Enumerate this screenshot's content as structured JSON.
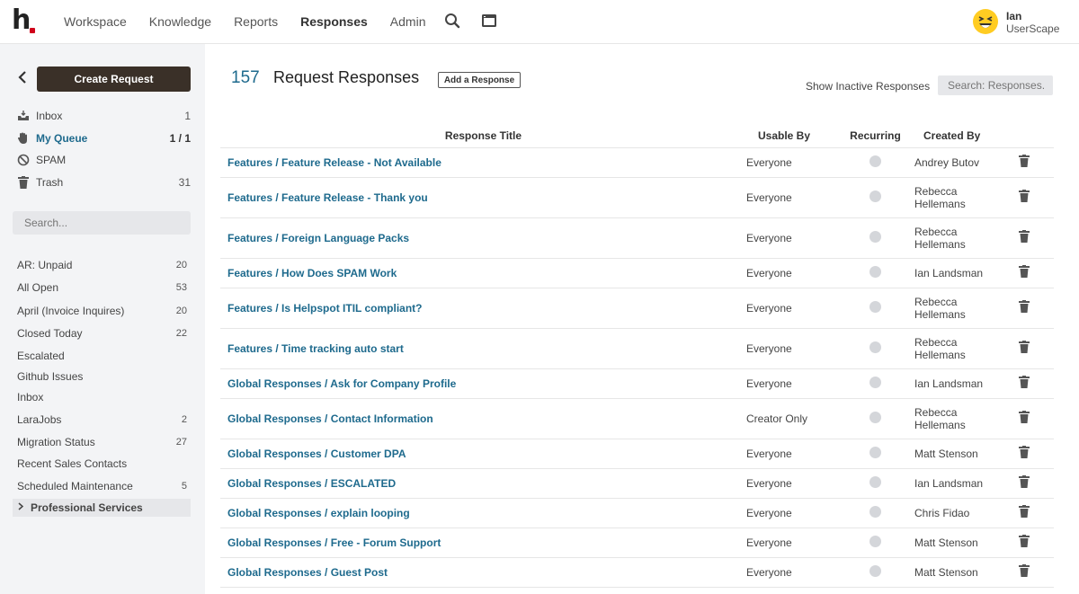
{
  "nav": {
    "items": [
      "Workspace",
      "Knowledge",
      "Reports",
      "Responses",
      "Admin"
    ],
    "active": "Responses",
    "search_icon": "search-icon",
    "window_icon": "window-icon"
  },
  "user": {
    "name": "Ian",
    "org": "UserScape",
    "avatar_icon": "laughing-face-emoji"
  },
  "sidebar": {
    "create_label": "Create Request",
    "folders": [
      {
        "label": "Inbox",
        "count": "1",
        "icon": "inbox-icon"
      },
      {
        "label": "My Queue",
        "count": "1 / 1",
        "icon": "hand-icon"
      },
      {
        "label": "SPAM",
        "count": "",
        "icon": "ban-icon"
      },
      {
        "label": "Trash",
        "count": "31",
        "icon": "trash-icon"
      }
    ],
    "search_placeholder": "Search...",
    "filters": [
      {
        "label": "AR: Unpaid",
        "count": "20"
      },
      {
        "label": "All Open",
        "count": "53"
      },
      {
        "label": "April (Invoice Inquires)",
        "count": "20"
      },
      {
        "label": "Closed Today",
        "count": "22"
      },
      {
        "label": "Escalated",
        "count": ""
      },
      {
        "label": "Github Issues",
        "count": ""
      },
      {
        "label": "Inbox",
        "count": ""
      },
      {
        "label": "LaraJobs",
        "count": "2"
      },
      {
        "label": "Migration Status",
        "count": "27"
      },
      {
        "label": "Recent Sales Contacts",
        "count": ""
      },
      {
        "label": "Scheduled Maintenance",
        "count": "5"
      }
    ],
    "group_label": "Professional Services"
  },
  "main": {
    "count": "157",
    "title": "Request Responses",
    "add_label": "Add a Response",
    "inactive_label": "Show Inactive Responses",
    "search_placeholder": "Search: Responses."
  },
  "table": {
    "headers": [
      "Response Title",
      "Usable By",
      "Recurring",
      "Created By"
    ],
    "rows": [
      {
        "title": "Features / Feature Release - Not Available",
        "usable": "Everyone",
        "creator": "Andrey Butov"
      },
      {
        "title": "Features / Feature Release - Thank you",
        "usable": "Everyone",
        "creator": "Rebecca Hellemans"
      },
      {
        "title": "Features / Foreign Language Packs",
        "usable": "Everyone",
        "creator": "Rebecca Hellemans"
      },
      {
        "title": "Features / How Does SPAM Work",
        "usable": "Everyone",
        "creator": "Ian Landsman"
      },
      {
        "title": "Features / Is Helpspot ITIL compliant?",
        "usable": "Everyone",
        "creator": "Rebecca Hellemans"
      },
      {
        "title": "Features / Time tracking auto start",
        "usable": "Everyone",
        "creator": "Rebecca Hellemans"
      },
      {
        "title": "Global Responses / Ask for Company Profile",
        "usable": "Everyone",
        "creator": "Ian Landsman"
      },
      {
        "title": "Global Responses / Contact Information",
        "usable": "Creator Only",
        "creator": "Rebecca Hellemans"
      },
      {
        "title": "Global Responses / Customer DPA",
        "usable": "Everyone",
        "creator": "Matt Stenson"
      },
      {
        "title": "Global Responses / ESCALATED",
        "usable": "Everyone",
        "creator": "Ian Landsman"
      },
      {
        "title": "Global Responses / explain looping",
        "usable": "Everyone",
        "creator": "Chris Fidao"
      },
      {
        "title": "Global Responses / Free - Forum Support",
        "usable": "Everyone",
        "creator": "Matt Stenson"
      },
      {
        "title": "Global Responses / Guest Post",
        "usable": "Everyone",
        "creator": "Matt Stenson"
      }
    ]
  },
  "colors": {
    "link": "#1e6a8d",
    "create_button": "#3a3028",
    "sidebar_bg": "#f3f4f6",
    "logo_dot": "#d0021b"
  }
}
